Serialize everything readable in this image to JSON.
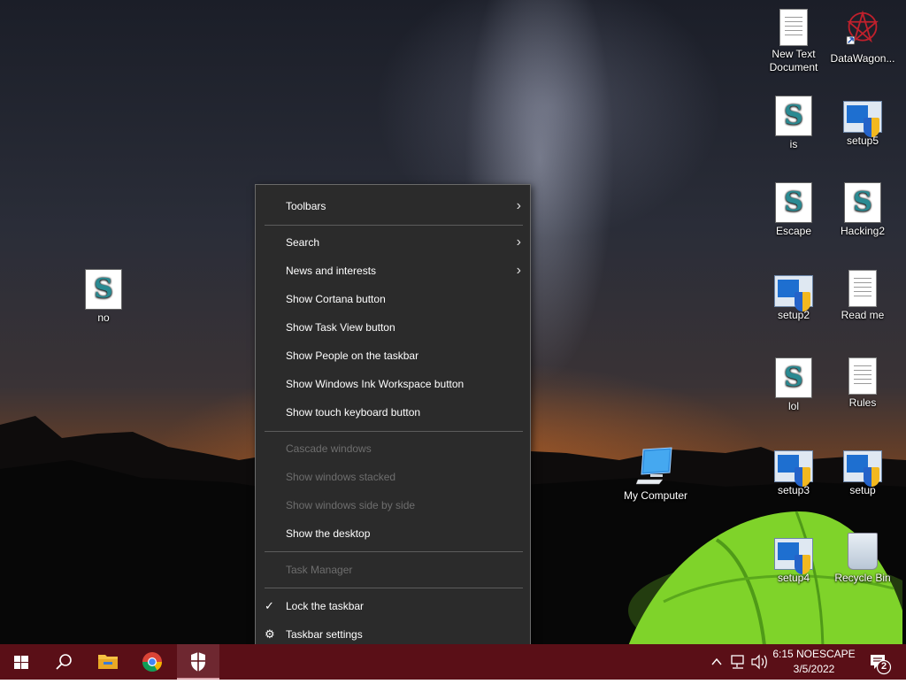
{
  "desktop": {
    "icons": [
      {
        "label": "New Text Document",
        "kind": "text"
      },
      {
        "label": "DataWagon...",
        "kind": "datawagon"
      },
      {
        "label": "is",
        "kind": "script"
      },
      {
        "label": "setup5",
        "kind": "setup"
      },
      {
        "label": "Escape",
        "kind": "script"
      },
      {
        "label": "Hacking2",
        "kind": "script"
      },
      {
        "label": "setup2",
        "kind": "setup"
      },
      {
        "label": "Read me",
        "kind": "text"
      },
      {
        "label": "lol",
        "kind": "script"
      },
      {
        "label": "Rules",
        "kind": "text"
      },
      {
        "label": "setup3",
        "kind": "setup"
      },
      {
        "label": "setup",
        "kind": "setup"
      },
      {
        "label": "setup4",
        "kind": "setup"
      },
      {
        "label": "Recycle Bin",
        "kind": "recycle-bin"
      },
      {
        "label": "My Computer",
        "kind": "computer"
      },
      {
        "label": "no",
        "kind": "script"
      }
    ]
  },
  "menu": {
    "items": [
      {
        "label": "Toolbars",
        "submenu": true
      },
      {
        "label": "Search",
        "submenu": true
      },
      {
        "label": "News and interests",
        "submenu": true
      },
      {
        "label": "Show Cortana button"
      },
      {
        "label": "Show Task View button"
      },
      {
        "label": "Show People on the taskbar"
      },
      {
        "label": "Show Windows Ink Workspace button"
      },
      {
        "label": "Show touch keyboard button"
      },
      {
        "label": "Cascade windows",
        "disabled": true
      },
      {
        "label": "Show windows stacked",
        "disabled": true
      },
      {
        "label": "Show windows side by side",
        "disabled": true
      },
      {
        "label": "Show the desktop"
      },
      {
        "label": "Task Manager",
        "disabled": true
      },
      {
        "label": "Lock the taskbar",
        "checked": true
      },
      {
        "label": "Taskbar settings",
        "icon": "gear-icon"
      }
    ],
    "arrow_glyph": "›",
    "check_glyph": "✓",
    "gear_glyph": "⚙"
  },
  "taskbar": {
    "time": "6:15 NOESCAPE",
    "date": "3/5/2022",
    "notification_count": "2",
    "color": "#5a0f17"
  }
}
